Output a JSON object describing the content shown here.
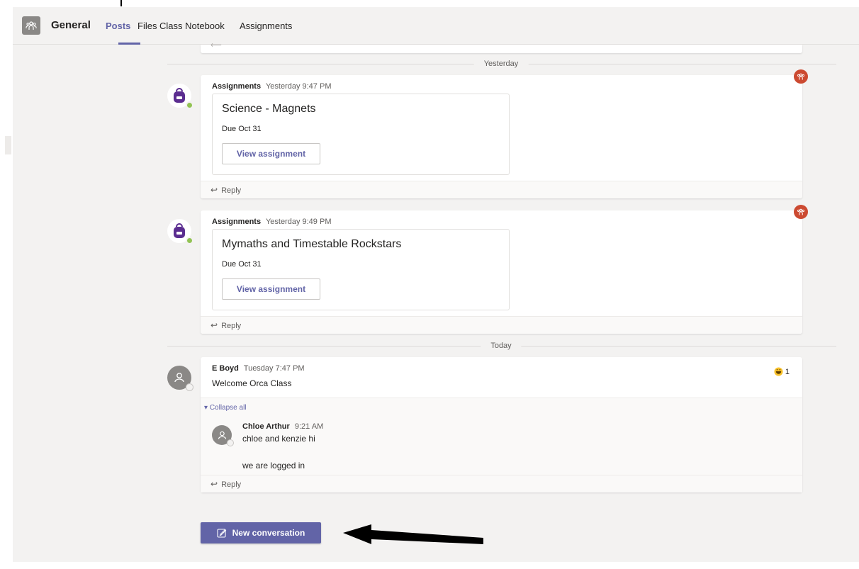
{
  "header": {
    "channel_name": "General",
    "tabs": [
      {
        "label": "Posts",
        "active": true
      },
      {
        "label": "Files",
        "active": false
      },
      {
        "label": "Class Notebook",
        "active": false
      },
      {
        "label": "Assignments",
        "active": false
      }
    ]
  },
  "dividers": {
    "yesterday": "Yesterday",
    "today": "Today"
  },
  "posts": [
    {
      "sender": "Assignments",
      "time": "Yesterday 9:47 PM",
      "title": "Science - Magnets",
      "due": "Due Oct 31",
      "button": "View assignment",
      "reply": "Reply"
    },
    {
      "sender": "Assignments",
      "time": "Yesterday 9:49 PM",
      "title": "Mymaths and Timestable Rockstars",
      "due": "Due Oct 31",
      "button": "View assignment",
      "reply": "Reply"
    }
  ],
  "conversation": {
    "sender": "E Boyd",
    "time": "Tuesday 7:47 PM",
    "text": "Welcome Orca Class",
    "reaction_count": "1",
    "collapse_label": "Collapse all",
    "reply": {
      "sender": "Chloe Arthur",
      "time": "9:21 AM",
      "line1": "chloe and kenzie hi",
      "line2": "we are logged in"
    },
    "reply_label": "Reply"
  },
  "new_conversation": "New conversation",
  "colors": {
    "accent": "#6264a7",
    "presence_online": "#92c353",
    "class_badge": "#cc4a31",
    "reaction": "#f8c12a"
  },
  "icons": {
    "team": "team-icon",
    "assignments_bot": "backpack-icon",
    "class": "class-team-icon",
    "reply": "reply-arrow-icon",
    "reaction": "laugh-emoji-icon",
    "compose": "compose-icon",
    "avatar": "person-icon"
  }
}
